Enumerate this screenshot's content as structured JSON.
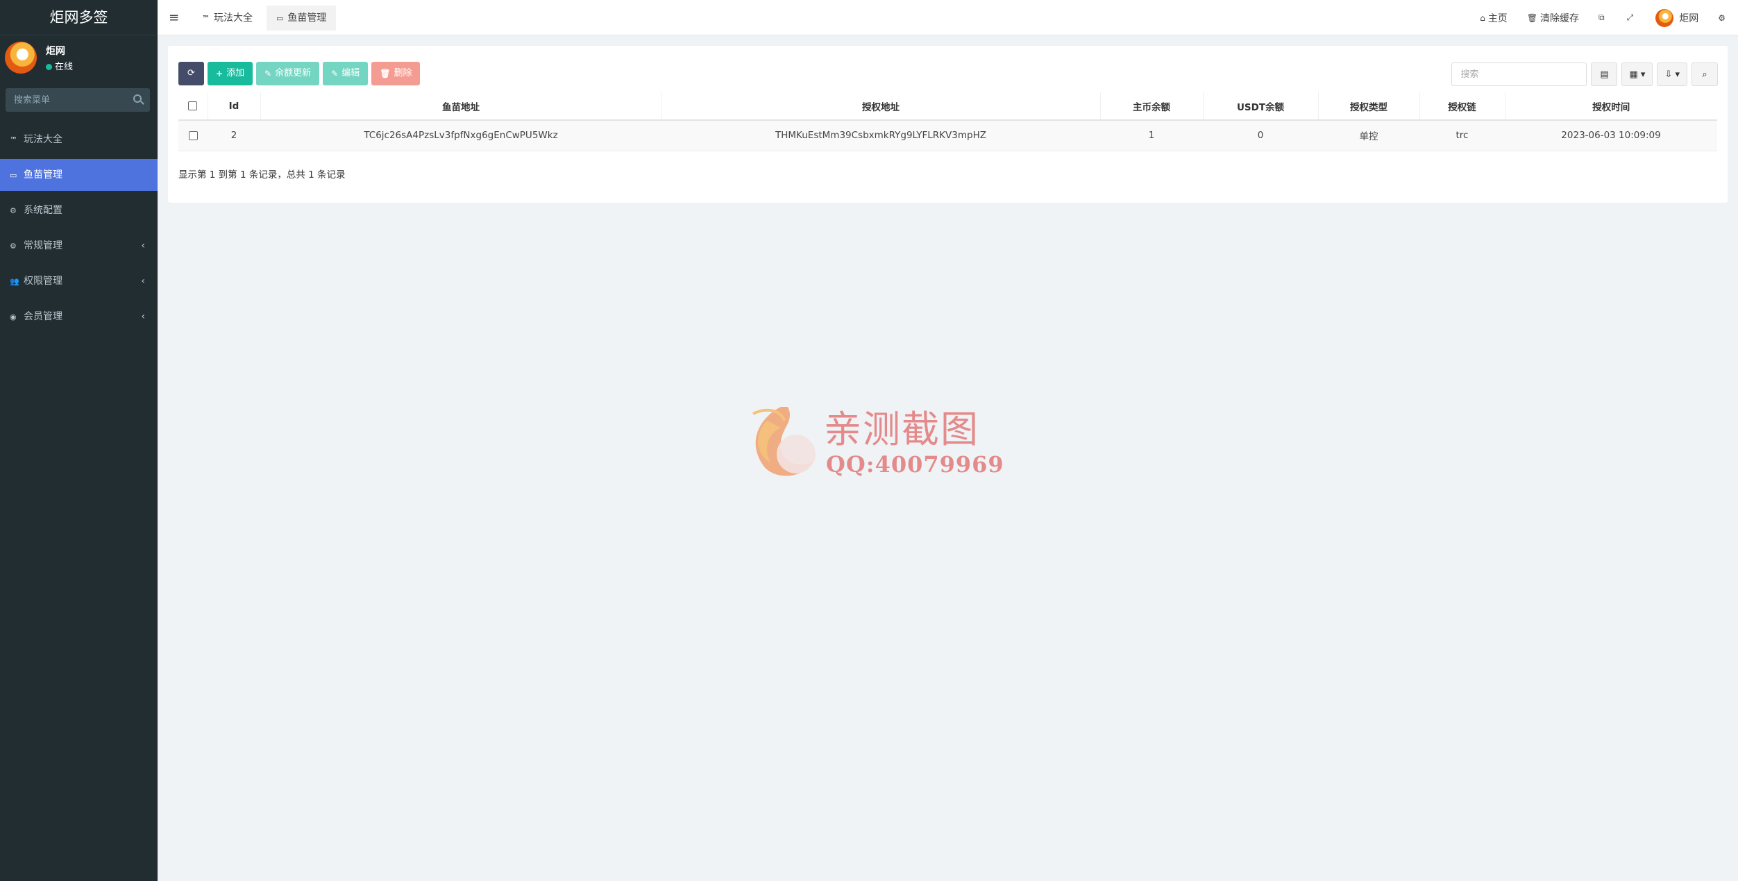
{
  "sidebar": {
    "brand": "炬网多签",
    "user": {
      "name": "炬网",
      "status": "在线"
    },
    "search_placeholder": "搜索菜单",
    "items": [
      {
        "icon": "TM",
        "label": "玩法大全"
      },
      {
        "icon": "wallet",
        "label": "鱼苗管理"
      },
      {
        "icon": "gear",
        "label": "系统配置"
      },
      {
        "icon": "cogs",
        "label": "常规管理"
      },
      {
        "icon": "group",
        "label": "权限管理"
      },
      {
        "icon": "user-circle",
        "label": "会员管理"
      }
    ],
    "arrow": "‹"
  },
  "topnav": {
    "tabs": [
      {
        "icon": "TM",
        "label": "玩法大全"
      },
      {
        "icon": "wallet",
        "label": "鱼苗管理"
      }
    ],
    "right": {
      "home_label": "主页",
      "clear_cache_label": "清除缓存",
      "user_name": "炬网"
    }
  },
  "toolbar": {
    "add_label": "添加",
    "balance_update_label": "余额更新",
    "edit_label": "编辑",
    "delete_label": "删除",
    "search_placeholder": "搜索"
  },
  "table": {
    "headers": [
      "Id",
      "鱼苗地址",
      "授权地址",
      "主币余额",
      "USDT余额",
      "授权类型",
      "授权链",
      "授权时间"
    ],
    "rows": [
      [
        "2",
        "TC6jc26sA4PzsLv3fpfNxg6gEnCwPU5Wkz",
        "THMKuEstMm39CsbxmkRYg9LYFLRKV3mpHZ",
        "1",
        "0",
        "单控",
        "trc",
        "2023-06-03 10:09:09"
      ]
    ]
  },
  "pager": {
    "summary": "显示第 1 到第 1 条记录，总共 1 条记录"
  },
  "watermark": {
    "text": "亲测截图",
    "qq": "QQ:40079969"
  },
  "colors": {
    "sidebar_bg": "#222d32",
    "active": "#4e73df",
    "success": "#18bc9c",
    "danger": "#f59c92",
    "dark_btn": "#444c69"
  }
}
